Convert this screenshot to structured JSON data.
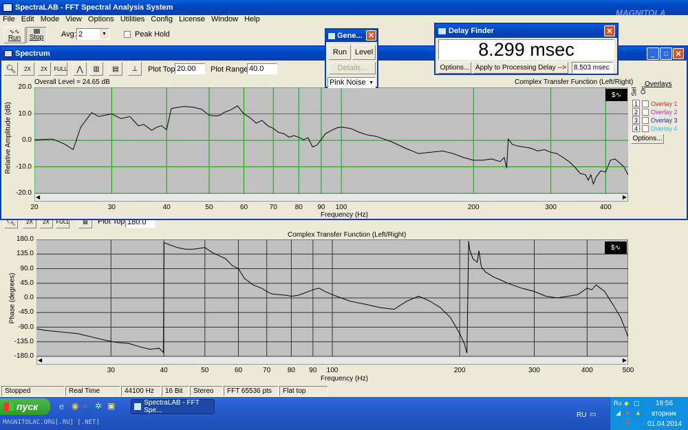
{
  "app": {
    "title": "SpectraLAB - FFT Spectral Analysis System",
    "watermark_logo": "MAGNITOLA"
  },
  "menu": [
    "File",
    "Edit",
    "Mode",
    "View",
    "Options",
    "Utilities",
    "Config",
    "License",
    "Window",
    "Help"
  ],
  "toolbar": {
    "run_label": "Run",
    "stop_label": "Stop",
    "avg_label": "Avg:",
    "avg_value": "2",
    "peak_hold_label": "Peak Hold"
  },
  "spectrum": {
    "title": "Spectrum",
    "plot_top_label": "Plot Top:",
    "plot_top_value": "20.00",
    "plot_range_label": "Plot Range:",
    "plot_range_value": "40.0",
    "overall_level": "Overall Level = 24.65 dB",
    "tool_labels": [
      "",
      "2X",
      "2X",
      "FULL"
    ]
  },
  "generator": {
    "title": "Gene...",
    "run_label": "Run",
    "level_label": "Level",
    "details_label": "Details...",
    "noise_value": "Pink Noise"
  },
  "delay_finder": {
    "title": "Delay Finder",
    "value": "8.299 msec",
    "options_label": "Options...",
    "apply_label": "Apply to Processing Delay -->",
    "applied_value": "8.503 msec"
  },
  "overlays": {
    "title": "Overlays",
    "sel_label": "Sel",
    "on_label": "On",
    "items": [
      {
        "num": "1",
        "label": "Overlay 1",
        "color": "#ff2020"
      },
      {
        "num": "2",
        "label": "Overlay 2",
        "color": "#e020e0"
      },
      {
        "num": "3",
        "label": "Overlay 3",
        "color": "#2020ff"
      },
      {
        "num": "4",
        "label": "Overlay 4",
        "color": "#00d0ff"
      }
    ],
    "options_label": "Options..."
  },
  "phase": {
    "plot_top_label": "Plot Top:",
    "plot_top_value": "180.0"
  },
  "status": [
    "Stopped",
    "Real Time",
    "44100 Hz",
    "16 Bit",
    "Stereo",
    "FFT 65536 pts",
    "Flat top"
  ],
  "taskbar": {
    "start_label": "пуск",
    "task_label": "SpectraLAB - FFT Spe...",
    "lang": "RU",
    "lang2": "Ru",
    "time": "18:56",
    "day": "вторник",
    "date": "01.04.2014",
    "footer": "MAGNITOLAC.ORG[.RU] [.NET]"
  },
  "chart_data": [
    {
      "type": "line",
      "title": "Complex Transfer Function (Left/Right)",
      "xlabel": "Frequency (Hz)",
      "ylabel": "Relative Amplitude (dB)",
      "xscale": "log",
      "xlim": [
        20,
        450
      ],
      "ylim": [
        -20,
        20
      ],
      "x_ticks": [
        20,
        30,
        40,
        50,
        60,
        70,
        80,
        90,
        100,
        200,
        300,
        400
      ],
      "y_ticks": [
        "20.0",
        "10.0",
        "0.0",
        "-10.0",
        "-20.0"
      ],
      "series": [
        {
          "color": "#000000",
          "x": [
            20,
            22,
            23.5,
            24.5,
            25.5,
            27,
            28,
            29,
            30,
            31.5,
            33,
            34.5,
            35.5,
            37,
            38,
            39,
            40,
            41,
            42.5,
            44,
            46,
            48,
            50,
            52,
            53,
            54,
            56,
            58,
            60,
            62,
            64,
            66,
            68,
            70,
            72,
            74,
            76,
            78,
            80,
            82,
            84,
            86,
            88,
            90,
            92,
            95,
            98,
            100,
            105,
            110,
            115,
            120,
            130,
            140,
            150,
            160,
            170,
            180,
            190,
            200,
            210,
            220,
            230,
            235,
            238,
            240,
            245,
            250,
            260,
            270,
            280,
            290,
            300,
            310,
            320,
            330,
            340,
            350,
            360,
            365,
            370,
            375,
            380,
            390,
            400,
            410,
            420,
            430,
            440,
            450
          ],
          "y": [
            0.2,
            0.5,
            -1.5,
            -3.5,
            5,
            10.5,
            9,
            9.5,
            10,
            8.2,
            9,
            5.5,
            6,
            3.8,
            5,
            5.5,
            4,
            12,
            12.5,
            12.8,
            12.5,
            11.8,
            9.5,
            9.2,
            9.5,
            10.5,
            11.5,
            13,
            10,
            8.5,
            6.5,
            7.5,
            5.5,
            4.5,
            3,
            2.5,
            1.2,
            1.8,
            1.2,
            0.2,
            1,
            -2.5,
            -1.8,
            0.3,
            2.5,
            3.8,
            4.8,
            5,
            4.5,
            3,
            2,
            1.5,
            -0.5,
            -3,
            -5,
            -4.5,
            -4,
            -5,
            -6.5,
            -7.5,
            -7.5,
            -7,
            -8,
            -6.5,
            -10.5,
            0.5,
            -1.5,
            -2,
            -2.5,
            -3,
            -4,
            -3.5,
            -4.5,
            -5,
            -6.5,
            -8,
            -10,
            -12.5,
            -13,
            -15,
            -13,
            -16.5,
            -14,
            -11.5,
            -12,
            -7.5,
            -7,
            -8.5,
            -10,
            -13
          ]
        }
      ]
    },
    {
      "type": "line",
      "title": "Complex Transfer Function (Left/Right)",
      "xlabel": "Frequency (Hz)",
      "ylabel": "Phase (degrees)",
      "xscale": "log",
      "xlim": [
        20,
        500
      ],
      "ylim": [
        -180,
        180
      ],
      "x_ticks": [
        30,
        40,
        50,
        60,
        70,
        80,
        90,
        100,
        200,
        300,
        400,
        500
      ],
      "y_ticks": [
        "180.0",
        "135.0",
        "90.0",
        "45.0",
        "0.0",
        "-45.0",
        "-90.0",
        "-135.0",
        "-180.0"
      ],
      "series": [
        {
          "color": "#000000",
          "x": [
            20,
            21,
            23,
            25,
            27,
            29,
            31,
            33,
            35,
            37,
            39,
            39.9,
            40.05,
            41,
            43,
            45,
            47,
            50,
            52,
            54,
            56,
            58,
            60,
            62,
            65,
            68,
            70,
            72,
            75,
            78,
            80,
            83,
            86,
            90,
            93,
            96,
            100,
            105,
            110,
            120,
            130,
            140,
            150,
            160,
            170,
            180,
            190,
            200,
            205,
            208,
            210,
            211,
            213,
            215,
            220,
            222,
            225,
            230,
            240,
            250,
            260,
            280,
            300,
            320,
            340,
            360,
            380,
            400,
            410,
            420,
            440,
            460,
            480,
            490,
            500
          ],
          "y": [
            -95,
            -100,
            -105,
            -110,
            -120,
            -130,
            -137,
            -140,
            -150,
            -158,
            -155,
            -168,
            170,
            165,
            155,
            150,
            150,
            155,
            140,
            130,
            120,
            100,
            90,
            60,
            40,
            30,
            20,
            12,
            10,
            8,
            5,
            8,
            15,
            25,
            30,
            20,
            10,
            0,
            -10,
            -20,
            -30,
            -35,
            -10,
            5,
            -10,
            -30,
            -60,
            -110,
            -140,
            -170,
            175,
            150,
            135,
            120,
            110,
            145,
            95,
            80,
            65,
            55,
            45,
            30,
            20,
            5,
            0,
            5,
            10,
            30,
            25,
            40,
            20,
            -20,
            -60,
            -90,
            -120
          ]
        }
      ]
    }
  ]
}
